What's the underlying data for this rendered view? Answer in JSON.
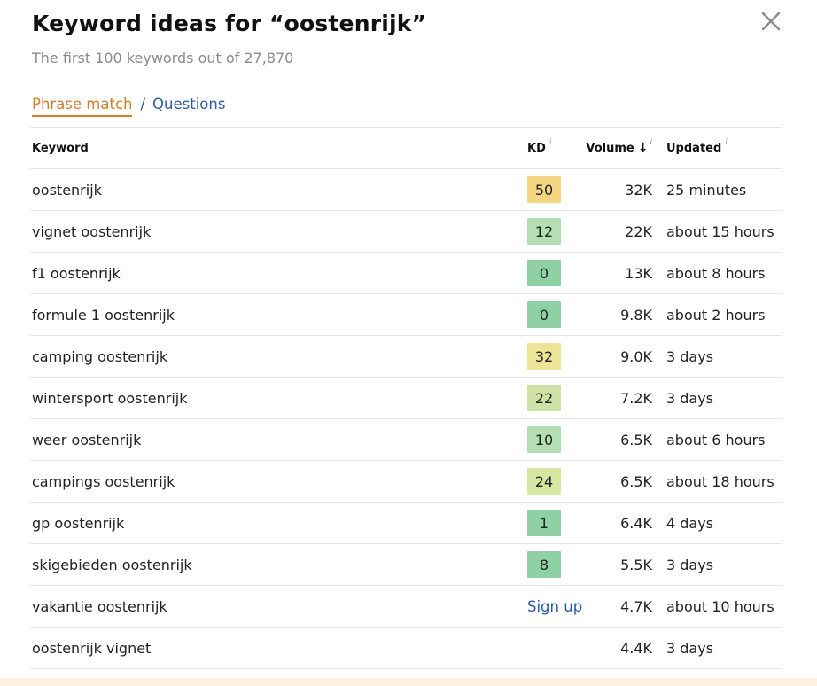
{
  "title": "Keyword ideas for “oostenrijk”",
  "subtitle": "The first 100 keywords out of 27,870",
  "close_icon": "close-icon",
  "tabs": {
    "phrase_match": "Phrase match",
    "separator": "/",
    "questions": "Questions"
  },
  "table": {
    "headers": {
      "keyword": "Keyword",
      "kd": "KD",
      "volume": "Volume",
      "updated": "Updated",
      "info_mark": "i",
      "sort_arrow": "↓"
    },
    "rows": [
      {
        "keyword": "oostenrijk",
        "kd": "50",
        "kd_color": "#f6d77e",
        "volume": "32K",
        "updated": "25 minutes"
      },
      {
        "keyword": "vignet oostenrijk",
        "kd": "12",
        "kd_color": "#b4e0b1",
        "volume": "22K",
        "updated": "about 15 hours"
      },
      {
        "keyword": "f1 oostenrijk",
        "kd": "0",
        "kd_color": "#8dd1a5",
        "volume": "13K",
        "updated": "about 8 hours"
      },
      {
        "keyword": "formule 1 oostenrijk",
        "kd": "0",
        "kd_color": "#8dd1a5",
        "volume": "9.8K",
        "updated": "about 2 hours"
      },
      {
        "keyword": "camping oostenrijk",
        "kd": "32",
        "kd_color": "#ede594",
        "volume": "9.0K",
        "updated": "3 days"
      },
      {
        "keyword": "wintersport oostenrijk",
        "kd": "22",
        "kd_color": "#cde3a4",
        "volume": "7.2K",
        "updated": "3 days"
      },
      {
        "keyword": "weer oostenrijk",
        "kd": "10",
        "kd_color": "#b4e0b1",
        "volume": "6.5K",
        "updated": "about 6 hours"
      },
      {
        "keyword": "campings oostenrijk",
        "kd": "24",
        "kd_color": "#d6e7a0",
        "volume": "6.5K",
        "updated": "about 18 hours"
      },
      {
        "keyword": "gp oostenrijk",
        "kd": "1",
        "kd_color": "#8dd1a5",
        "volume": "6.4K",
        "updated": "4 days"
      },
      {
        "keyword": "skigebieden oostenrijk",
        "kd": "8",
        "kd_color": "#8dd1a5",
        "volume": "5.5K",
        "updated": "3 days"
      },
      {
        "keyword": "vakantie oostenrijk",
        "kd": "",
        "kd_link": "Sign up",
        "volume": "4.7K",
        "updated": "about 10 hours"
      },
      {
        "keyword": "oostenrijk vignet",
        "kd": "",
        "volume": "4.4K",
        "updated": "3 days"
      }
    ]
  },
  "colors": {
    "accent_orange": "#e07b1c",
    "link_blue": "#2558c4",
    "footer_tint": "#fdf1e4"
  }
}
